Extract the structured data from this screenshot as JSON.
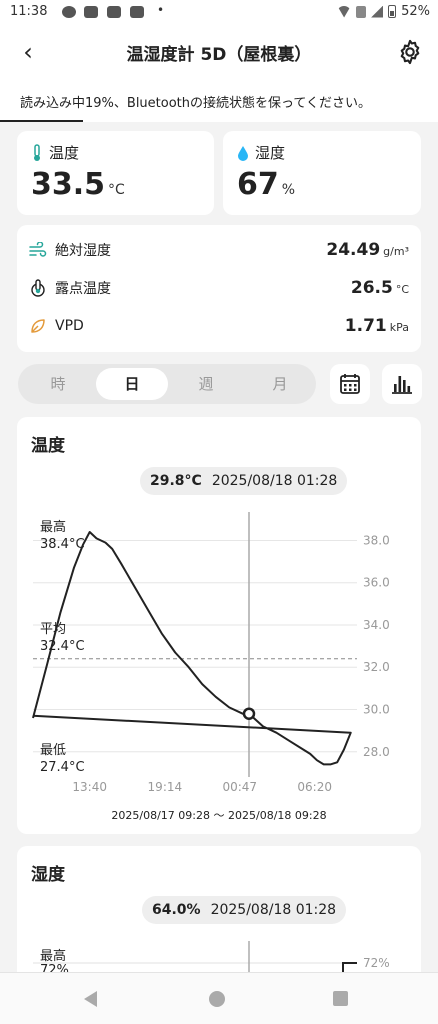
{
  "status": {
    "time": "11:38",
    "dot": "•",
    "battery": "52%",
    "icons": [
      "line-icon",
      "youtube-icon",
      "youtube-icon",
      "youtube-icon",
      "wifi-icon",
      "sim-icon",
      "signal-icon",
      "battery-icon"
    ]
  },
  "appbar": {
    "back": "‹",
    "title": "温湿度計 5D（屋根裏）",
    "icons": [
      "back-arrow-icon",
      "gear-icon"
    ]
  },
  "banner": {
    "text": "読み込み中19%、Bluetoothの接続状態を保ってください。",
    "progress": 0.19
  },
  "temp_card": {
    "label": "温度",
    "value": "33.5",
    "unit": "°C",
    "icon": "thermometer-icon",
    "icon_color": "#26a69a"
  },
  "humidity_card": {
    "label": "湿度",
    "value": "67",
    "unit": "%",
    "icon": "droplet-icon",
    "icon_color": "#29b6f6"
  },
  "metrics": [
    {
      "label": "絶対湿度",
      "value": "24.49",
      "unit": "g/m³",
      "icon": "wind-icon"
    },
    {
      "label": "露点温度",
      "value": "26.5",
      "unit": "°C",
      "icon": "dew-point-icon"
    },
    {
      "label": "VPD",
      "value": "1.71",
      "unit": "kPa",
      "icon": "leaf-icon"
    }
  ],
  "tabs": {
    "options": [
      "時",
      "日",
      "週",
      "月"
    ],
    "active_index": 1,
    "icons": [
      "calendar-icon",
      "bar-chart-icon"
    ]
  },
  "temp_chart": {
    "title": "温度",
    "cursor_value": "29.8°C",
    "cursor_time": "2025/08/18 01:28",
    "max_label": "最高",
    "max_value": "38.4°C",
    "avg_label": "平均",
    "avg_value": "32.4°C",
    "min_label": "最低",
    "min_value": "27.4°C",
    "range": "2025/08/17 09:28 ～ 2025/08/18 09:28"
  },
  "humidity_chart": {
    "title": "湿度",
    "cursor_value": "64.0%",
    "cursor_time": "2025/08/18 01:28",
    "max_label": "最高",
    "max_value": "72%",
    "ytick_top": "72%"
  },
  "chart_data": [
    {
      "type": "line",
      "title": "温度",
      "xlabel": "",
      "ylabel": "",
      "x_ticks": [
        "13:40",
        "19:14",
        "00:47",
        "06:20"
      ],
      "y_ticks": [
        28.0,
        30.0,
        32.0,
        34.0,
        36.0,
        38.0
      ],
      "ylim": [
        26.9,
        39.3
      ],
      "grid": true,
      "average": 32.4,
      "cursor": {
        "x": "2025/08/18 01:28",
        "y": 29.8
      },
      "x": [
        "09:28",
        "10:30",
        "11:30",
        "12:30",
        "13:10",
        "13:40",
        "14:10",
        "14:50",
        "15:20",
        "16:00",
        "17:00",
        "18:00",
        "19:00",
        "20:00",
        "21:00",
        "22:00",
        "23:00",
        "00:00",
        "01:00",
        "01:28",
        "02:30",
        "03:30",
        "04:30",
        "05:30",
        "06:00",
        "06:30",
        "07:00",
        "07:30",
        "08:00",
        "08:30",
        "09:00",
        "09:28"
      ],
      "y": [
        29.6,
        32.1,
        34.6,
        36.7,
        37.8,
        38.4,
        38.1,
        37.9,
        37.6,
        36.9,
        35.8,
        34.7,
        33.6,
        32.7,
        32.0,
        31.2,
        30.6,
        30.1,
        29.8,
        29.8,
        29.2,
        28.9,
        28.5,
        28.1,
        27.9,
        27.6,
        27.4,
        27.4,
        27.5,
        28.1,
        28.9,
        29.7
      ]
    },
    {
      "type": "line",
      "title": "湿度",
      "xlabel": "",
      "ylabel": "",
      "y_ticks": [
        72
      ],
      "cursor": {
        "x": "2025/08/18 01:28",
        "y": 64.0
      },
      "max": 72
    }
  ]
}
